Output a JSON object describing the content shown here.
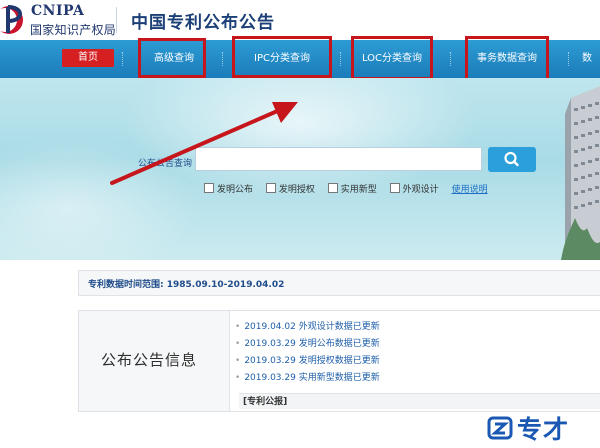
{
  "header": {
    "logo_en": "CNIPA",
    "logo_cn": "国家知识产权局",
    "site_title": "中国专利公布公告"
  },
  "nav": {
    "home": "首页",
    "items": [
      "高级查询",
      "IPC分类查询",
      "LOC分类查询",
      "事务数据查询",
      "数"
    ]
  },
  "search": {
    "label": "公布公告查询",
    "value": "",
    "placeholder": "",
    "options": [
      "发明公布",
      "发明授权",
      "实用新型",
      "外观设计"
    ],
    "help_link": "使用说明"
  },
  "range": {
    "text": "专利数据时间范围: 1985.09.10-2019.04.02"
  },
  "announcements": {
    "title": "公布公告信息",
    "items": [
      "2019.04.02 外观设计数据已更新",
      "2019.03.29 发明公布数据已更新",
      "2019.03.29 发明授权数据已更新",
      "2019.03.29 实用新型数据已更新"
    ],
    "notice_tag": "[专利公报]"
  },
  "watermark": {
    "text": "专才"
  },
  "colors": {
    "nav_blue": "#2d9bd4",
    "home_red": "#d61f21",
    "highlight_red": "#c6151b",
    "link_blue": "#1f5fa9",
    "brand_navy": "#20386f"
  },
  "icons": {
    "search_button": "magnifier-icon",
    "logo": "cnipa-logo-icon",
    "annotation": "red-arrow-icon"
  }
}
